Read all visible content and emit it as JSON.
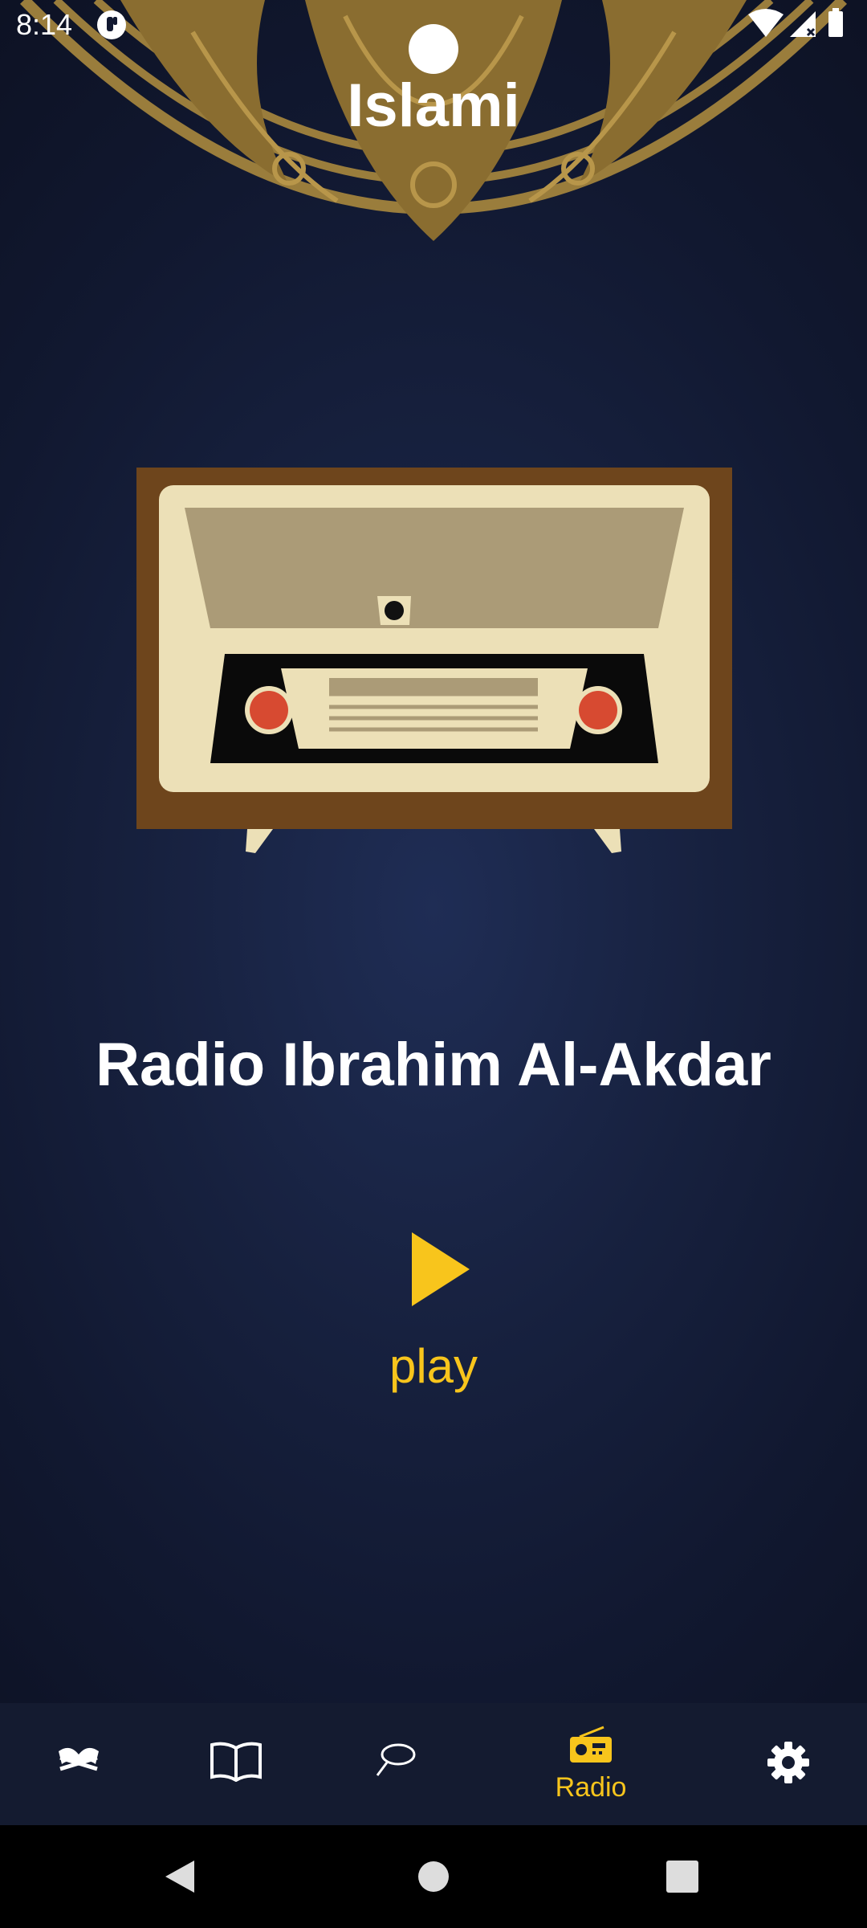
{
  "status_bar": {
    "time": "8:14",
    "icons": [
      "app-notification-icon",
      "wifi-icon",
      "cell-signal-icon",
      "battery-icon"
    ]
  },
  "app": {
    "title": "Islami"
  },
  "radio": {
    "station_name": "Radio Ibrahim Al-Akdar",
    "play_label": "play",
    "accent_color": "#f8c51c"
  },
  "bottom_nav": {
    "items": [
      {
        "icon": "quran-icon",
        "label": "",
        "active": false
      },
      {
        "icon": "hadith-book-icon",
        "label": "",
        "active": false
      },
      {
        "icon": "sebha-icon",
        "label": "",
        "active": false
      },
      {
        "icon": "radio-icon",
        "label": "Radio",
        "active": true
      },
      {
        "icon": "gear-icon",
        "label": "",
        "active": false
      }
    ]
  },
  "system_nav": {
    "buttons": [
      "back-icon",
      "home-icon",
      "recents-icon"
    ]
  }
}
